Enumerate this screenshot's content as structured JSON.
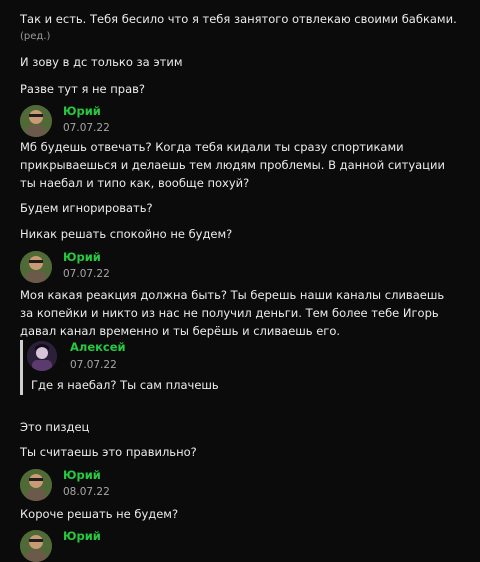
{
  "messages": {
    "m1": "Так и есть. Тебя бесило что я тебя занятого отвлекаю своими бабками.",
    "m1_edited": "(ред.)",
    "m2": "И зову в дс только за этим",
    "m3": "Разве тут я не прав?",
    "p1": {
      "author": "Юрий",
      "date": "07.07.22"
    },
    "m4": "Мб будешь отвечать? Когда тебя кидали ты сразу спортиками прикрываешься и делаешь тем людям проблемы. В данной ситуации ты наебал и типо как, вообще похуй?",
    "m5": "Будем игнорировать?",
    "m6": "Никак решать спокойно не будем?",
    "p2": {
      "author": "Юрий",
      "date": "07.07.22"
    },
    "m7": "Моя какая реакция должна быть? Ты берешь наши каналы сливаешь за копейки и никто из нас не получил деньги. Тем более тебе Игорь давал канал временно и ты берёшь и сливаешь его.",
    "p3": {
      "author": "Алексей",
      "date": "07.07.22",
      "text": "Где я наебал? Ты сам плачешь"
    },
    "m8": "Это пиздец",
    "m9": "Ты считаешь это правильно?",
    "p4": {
      "author": "Юрий",
      "date": "08.07.22"
    },
    "m10": "Короче решать не будем?",
    "p5": {
      "author": "Юрий"
    }
  },
  "colors": {
    "author": "#27c93f",
    "background": "#0b0b0b",
    "text": "#ececec"
  }
}
